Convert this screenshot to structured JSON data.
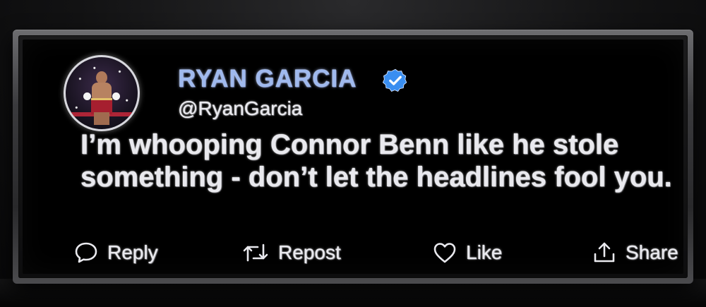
{
  "profile": {
    "name": "RYAN GARCIA",
    "handle": "@RyanGarcia",
    "verified": true,
    "avatar_icon": "boxer-avatar"
  },
  "tweet": {
    "text": "I’m whooping Connor Benn like he stole something - don’t let the headlines fool you."
  },
  "actions": {
    "reply": {
      "label": "Reply",
      "icon": "speech-bubble-icon"
    },
    "repost": {
      "label": "Repost",
      "icon": "repost-arrows-icon"
    },
    "like": {
      "label": "Like",
      "icon": "heart-icon"
    },
    "share": {
      "label": "Share",
      "icon": "share-arrow-icon"
    }
  },
  "colors": {
    "name": "#9fb9ee",
    "verified_badge": "#3a8ef0",
    "text": "#e9e9ee",
    "card_background": "#000000"
  }
}
